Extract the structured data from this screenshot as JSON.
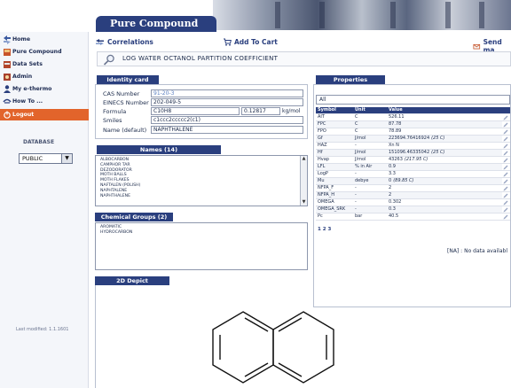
{
  "header": {
    "page_title": "Pure Compound"
  },
  "sidebar": {
    "items": [
      {
        "label": "Home",
        "icon": "arrows-icon"
      },
      {
        "label": "Pure Compound",
        "icon": "flask-icon"
      },
      {
        "label": "Data Sets",
        "icon": "dataset-icon"
      },
      {
        "label": "Admin",
        "icon": "admin-icon"
      },
      {
        "label": "My e-thermo",
        "icon": "user-icon"
      },
      {
        "label": "How To ...",
        "icon": "help-icon"
      },
      {
        "label": "Logout",
        "icon": "power-icon"
      }
    ],
    "database_label": "DATABASE",
    "database_value": "PUBLIC",
    "last_modified": "Last modified: 1.1.1601"
  },
  "toolbar": {
    "correlations": "Correlations",
    "add_to_cart": "Add To Cart",
    "send": "Send ma"
  },
  "property_title": "LOG WATER OCTANOL PARTITION COEFFICIENT",
  "identity": {
    "title": "Identity card",
    "cas_label": "CAS Number",
    "cas_value": "91-20-3",
    "einecs_label": "EINECS Number",
    "einecs_value": "202-049-5",
    "formula_label": "Formula",
    "formula_value": "C10H8",
    "mw_value": "0.12817",
    "mw_unit": "kg/mol",
    "smiles_label": "Smiles",
    "smiles_value": "c1ccc2ccccc2(c1)",
    "name_label": "Name (default)",
    "name_value": "NAPHTHALENE"
  },
  "names": {
    "title": "Names (14)",
    "items": [
      "ALBOCARBON",
      "CAMPHOR TAR",
      "DEZODORATOR",
      "MOTH BALLS",
      "MOTH FLAKES",
      "NAFTALEN (POLISH)",
      "NAPHTALENE",
      "NAPHTHALENE"
    ]
  },
  "groups": {
    "title": "Chemical Groups (2)",
    "items": [
      "AROMATIC",
      "HYDROCARBON"
    ]
  },
  "properties": {
    "title": "Properties",
    "filter": "All",
    "headers": [
      "Symbol",
      "Unit",
      "Value"
    ],
    "rows": [
      {
        "symbol": "AIT",
        "unit": "C",
        "value": "526.11"
      },
      {
        "symbol": "FPC",
        "unit": "C",
        "value": "87.78"
      },
      {
        "symbol": "FPO",
        "unit": "C",
        "value": "78.89"
      },
      {
        "symbol": "Gf",
        "unit": "J/mol",
        "value": "223694.76416924",
        "cond": "(25 C)"
      },
      {
        "symbol": "HAZ",
        "unit": "-",
        "value": "Xn N"
      },
      {
        "symbol": "Hf",
        "unit": "J/mol",
        "value": "151096.46335042",
        "cond": "(25 C)"
      },
      {
        "symbol": "Hvap",
        "unit": "J/mol",
        "value": "43263",
        "cond": "(217.95 C)"
      },
      {
        "symbol": "LFL",
        "unit": "% in Air",
        "value": "0.9"
      },
      {
        "symbol": "LogP",
        "unit": "-",
        "value": "3.3"
      },
      {
        "symbol": "Mu",
        "unit": "debye",
        "value": "0",
        "cond": "(89.85 C)"
      },
      {
        "symbol": "NFPA_F",
        "unit": "-",
        "value": "2"
      },
      {
        "symbol": "NFPA_H",
        "unit": "-",
        "value": "2"
      },
      {
        "symbol": "OMEGA",
        "unit": "-",
        "value": "0.302"
      },
      {
        "symbol": "OMEGA_SRK",
        "unit": "-",
        "value": "0.3"
      },
      {
        "symbol": "Pc",
        "unit": "bar",
        "value": "40.5"
      }
    ],
    "pages": "1 2 3",
    "note": "[NA] : No data availabl"
  },
  "depict": {
    "title": "2D Depict"
  },
  "colors": {
    "brand": "#2a3f7e",
    "logout": "#e2642b",
    "link": "#5a7fc0"
  }
}
